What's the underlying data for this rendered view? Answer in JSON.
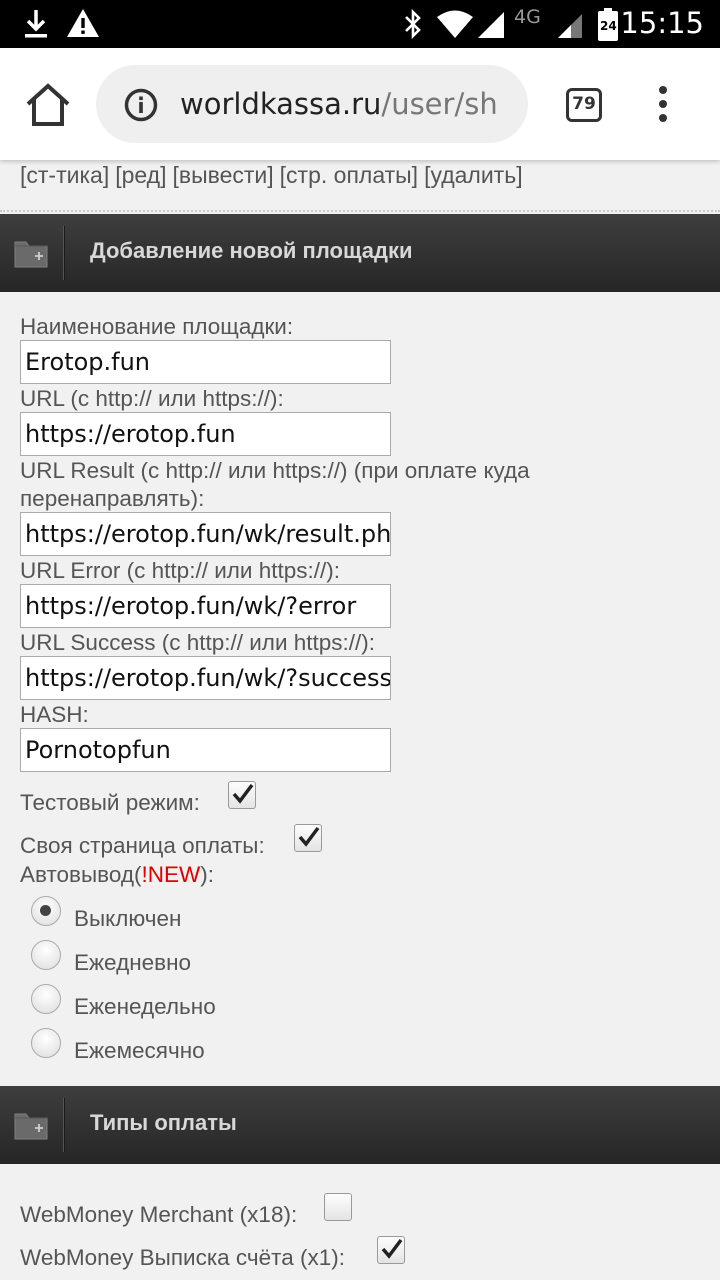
{
  "status_bar": {
    "time": "15:15",
    "network": "4G",
    "battery_level": "24",
    "icons": [
      "download-icon",
      "warning-icon",
      "bluetooth-icon",
      "wifi-icon",
      "signal-icon",
      "signal-icon",
      "battery-icon"
    ]
  },
  "browser": {
    "url_domain": "worldkassa.ru",
    "url_path": "/user/sh",
    "tab_count": "79"
  },
  "nav_links": [
    "[ст-тика]",
    "[ред]",
    "[вывести]",
    "[стр. оплаты]",
    "[удалить]"
  ],
  "section_add": {
    "title": "Добавление новой площадки"
  },
  "form": {
    "name_label": "Наименование площадки:",
    "name_value": "Erotop.fun",
    "url_label": "URL (с http:// или https://):",
    "url_value": "https://erotop.fun",
    "result_label_line1": "URL Result (с http:// или https://) (при оплате куда",
    "result_label_line2": "перенаправлять):",
    "result_value": "https://erotop.fun/wk/result.ph",
    "error_label": "URL Error (с http:// или https://):",
    "error_value": "https://erotop.fun/wk/?error",
    "success_label": "URL Success (с http:// или https://):",
    "success_value": "https://erotop.fun/wk/?success",
    "hash_label": "HASH:",
    "hash_value": "Pornotopfun",
    "test_mode_label": "Тестовый режим:",
    "test_mode_checked": true,
    "own_page_label": "Своя страница оплаты:",
    "own_page_checked": true,
    "autowithdraw_label_prefix": "Автовывод(",
    "autowithdraw_label_new": "!NEW",
    "autowithdraw_label_suffix": "):",
    "autowithdraw_options": [
      "Выключен",
      "Ежедневно",
      "Еженедельно",
      "Ежемесячно"
    ],
    "autowithdraw_selected": "Выключен"
  },
  "section_payments": {
    "title": "Типы оплаты",
    "items": [
      {
        "label": "WebMoney Merchant (x18):",
        "checked": false
      },
      {
        "label": "WebMoney Выписка счёта (x1):",
        "checked": true
      }
    ]
  }
}
